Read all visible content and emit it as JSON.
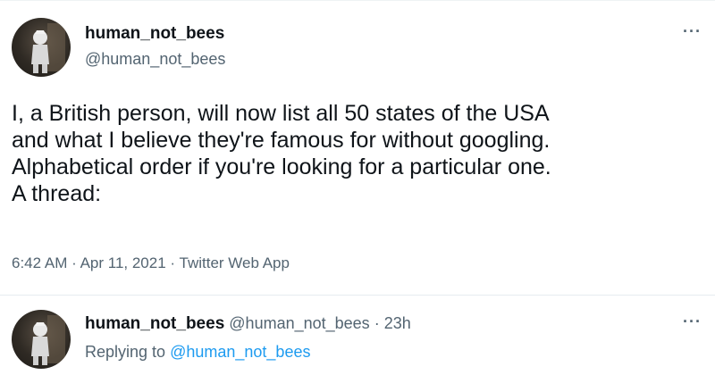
{
  "main_tweet": {
    "display_name": "human_not_bees",
    "handle": "@human_not_bees",
    "more_icon": "more-horizontal-icon",
    "text_lines": [
      "I, a British person, will now list all 50 states of the USA",
      "and what I believe they're famous for without googling.",
      "Alphabetical order if you're looking for a particular one.",
      "A thread:"
    ],
    "time": "6:42 AM",
    "date": "Apr 11, 2021",
    "source": "Twitter Web App",
    "separator": "·"
  },
  "reply_tweet": {
    "display_name": "human_not_bees",
    "handle": "@human_not_bees",
    "separator": "·",
    "age": "23h",
    "replying_prefix": "Replying to",
    "replying_handle": "@human_not_bees",
    "more_icon": "more-horizontal-icon"
  },
  "colors": {
    "text": "#0f1419",
    "secondary": "#536471",
    "link": "#1d9bf0"
  }
}
